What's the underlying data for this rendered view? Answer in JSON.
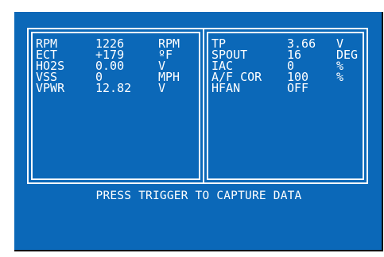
{
  "left_panel": {
    "rows": [
      {
        "label": "RPM",
        "value": "1226",
        "unit": "RPM"
      },
      {
        "label": "ECT",
        "value": "+179",
        "unit": "ºF"
      },
      {
        "label": "HO2S",
        "value": "0.00",
        "unit": "V"
      },
      {
        "label": "VSS",
        "value": "0",
        "unit": "MPH"
      },
      {
        "label": "VPWR",
        "value": "12.82",
        "unit": "V"
      }
    ]
  },
  "right_panel": {
    "rows": [
      {
        "label": "TP",
        "value": "3.66",
        "unit": "V"
      },
      {
        "label": "SPOUT",
        "value": "16",
        "unit": "DEG"
      },
      {
        "label": "IAC",
        "value": "0",
        "unit": "%"
      },
      {
        "label": "A/F COR",
        "value": "100",
        "unit": "%"
      },
      {
        "label": "HFAN",
        "value": "OFF",
        "unit": ""
      }
    ]
  },
  "footer": {
    "prompt": "PRESS TRIGGER TO CAPTURE DATA"
  },
  "colors": {
    "screen_bg": "#0b68b8",
    "text": "#ffffff"
  }
}
